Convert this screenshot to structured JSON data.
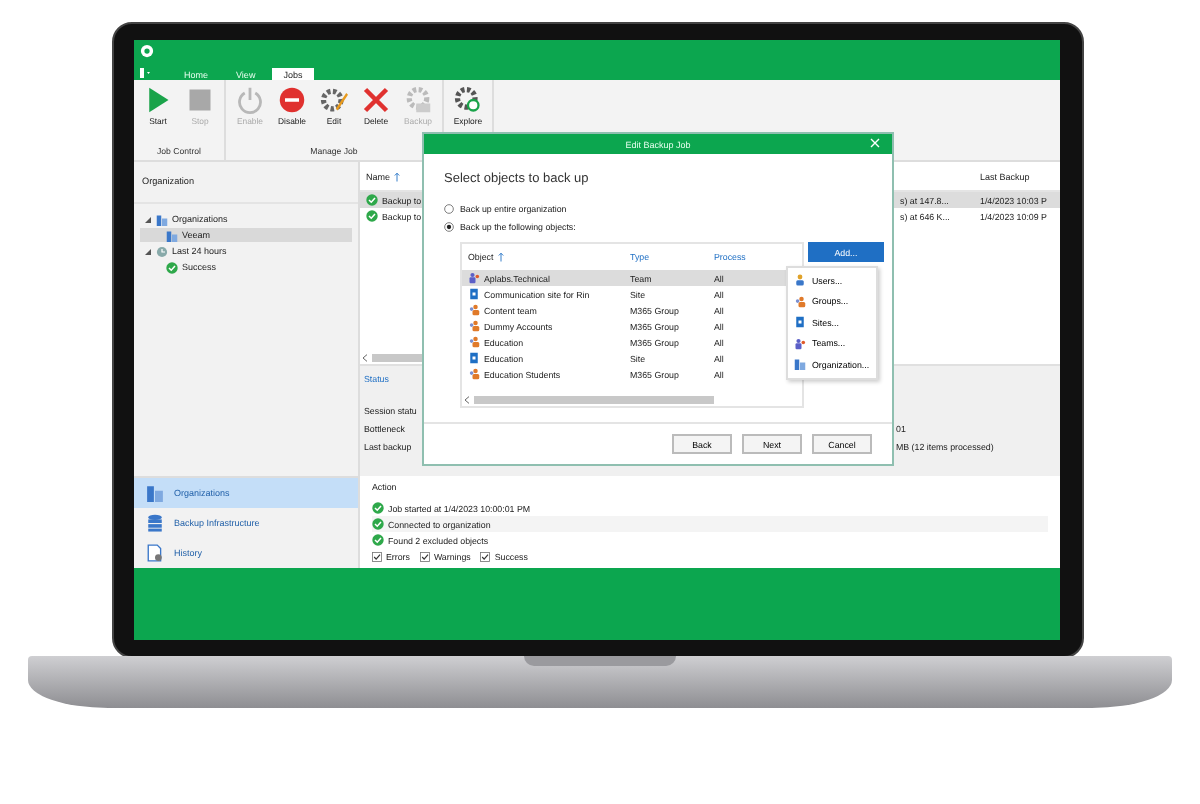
{
  "tabs": [
    {
      "label": "Home",
      "selected": false
    },
    {
      "label": "View",
      "selected": false
    },
    {
      "label": "Jobs",
      "selected": true
    }
  ],
  "ribbon": {
    "groups": [
      {
        "label": "Job Control",
        "buttons": [
          {
            "label": "Start",
            "kind": "play",
            "disabled": false
          },
          {
            "label": "Stop",
            "kind": "stop",
            "disabled": true
          }
        ]
      },
      {
        "label": "Manage Job",
        "buttons": [
          {
            "label": "Enable",
            "kind": "power",
            "disabled": true
          },
          {
            "label": "Disable",
            "kind": "block",
            "disabled": false
          },
          {
            "label": "Edit",
            "kind": "edit",
            "disabled": false
          },
          {
            "label": "Delete",
            "kind": "delete",
            "disabled": false
          },
          {
            "label": "Backup",
            "kind": "copy",
            "disabled": true
          }
        ]
      },
      {
        "buttons": [
          {
            "label": "Explore",
            "kind": "explore",
            "disabled": false
          }
        ]
      }
    ]
  },
  "sidebar": {
    "header": "Organization",
    "tree": [
      {
        "label": "Organizations",
        "kind": "org",
        "expanded": true,
        "selected": false,
        "children": [
          {
            "label": "Veeam",
            "kind": "org",
            "selected": true
          }
        ]
      },
      {
        "label": "Last 24 hours",
        "kind": "clock",
        "expanded": true,
        "selected": false,
        "children": [
          {
            "label": "Success",
            "kind": "success",
            "selected": false
          }
        ]
      }
    ],
    "nav": [
      {
        "label": "Organizations",
        "kind": "org",
        "selected": true
      },
      {
        "label": "Backup Infrastructure",
        "kind": "db",
        "selected": false
      },
      {
        "label": "History",
        "kind": "history",
        "selected": false
      }
    ]
  },
  "jobs": {
    "columns": [
      {
        "label": "Name",
        "sorted": true
      },
      {
        "label": "Last Backup",
        "sorted": false
      }
    ],
    "rows": [
      {
        "name": "Backup to",
        "detail": "s) at 147.8...",
        "last": "1/4/2023 10:03 P",
        "selected": true
      },
      {
        "name": "Backup to",
        "detail": "s) at 646 K...",
        "last": "1/4/2023 10:09 P",
        "selected": false
      }
    ]
  },
  "status": {
    "title": "Status",
    "rows": [
      {
        "label": "Session statu",
        "value": ""
      },
      {
        "label": "Bottleneck",
        "value": "01"
      },
      {
        "label": "Last backup",
        "value": "MB (12 items processed)"
      }
    ]
  },
  "action": {
    "title": "Action",
    "items": [
      "Job started at 1/4/2023 10:00:01 PM",
      "Connected to organization",
      "Found 2 excluded objects"
    ],
    "filters": [
      {
        "label": "Errors",
        "checked": true
      },
      {
        "label": "Warnings",
        "checked": true
      },
      {
        "label": "Success",
        "checked": true
      }
    ]
  },
  "dialog": {
    "title": "Edit Backup Job",
    "heading": "Select objects to back up",
    "options": [
      {
        "label": "Back up entire organization",
        "selected": false
      },
      {
        "label": "Back up the following objects:",
        "selected": true
      }
    ],
    "columns": [
      {
        "label": "Object",
        "sorted": true
      },
      {
        "label": "Type",
        "sorted": false
      },
      {
        "label": "Process",
        "sorted": false
      }
    ],
    "rows": [
      {
        "object": "Aplabs.Technical",
        "type": "Team",
        "process": "All",
        "kind": "team",
        "selected": true
      },
      {
        "object": "Communication site for Rin",
        "type": "Site",
        "process": "All",
        "kind": "site",
        "selected": false
      },
      {
        "object": "Content team",
        "type": "M365 Group",
        "process": "All",
        "kind": "group",
        "selected": false
      },
      {
        "object": "Dummy Accounts",
        "type": "M365 Group",
        "process": "All",
        "kind": "group",
        "selected": false
      },
      {
        "object": "Education",
        "type": "M365 Group",
        "process": "All",
        "kind": "group",
        "selected": false
      },
      {
        "object": "Education",
        "type": "Site",
        "process": "All",
        "kind": "site",
        "selected": false
      },
      {
        "object": "Education Students",
        "type": "M365 Group",
        "process": "All",
        "kind": "group",
        "selected": false
      }
    ],
    "add_button": "Add...",
    "add_menu": [
      {
        "label": "Users...",
        "kind": "user"
      },
      {
        "label": "Groups...",
        "kind": "group"
      },
      {
        "label": "Sites...",
        "kind": "site"
      },
      {
        "label": "Teams...",
        "kind": "team"
      },
      {
        "label": "Organization...",
        "kind": "org"
      }
    ],
    "buttons": [
      "Back",
      "Next",
      "Cancel"
    ]
  }
}
